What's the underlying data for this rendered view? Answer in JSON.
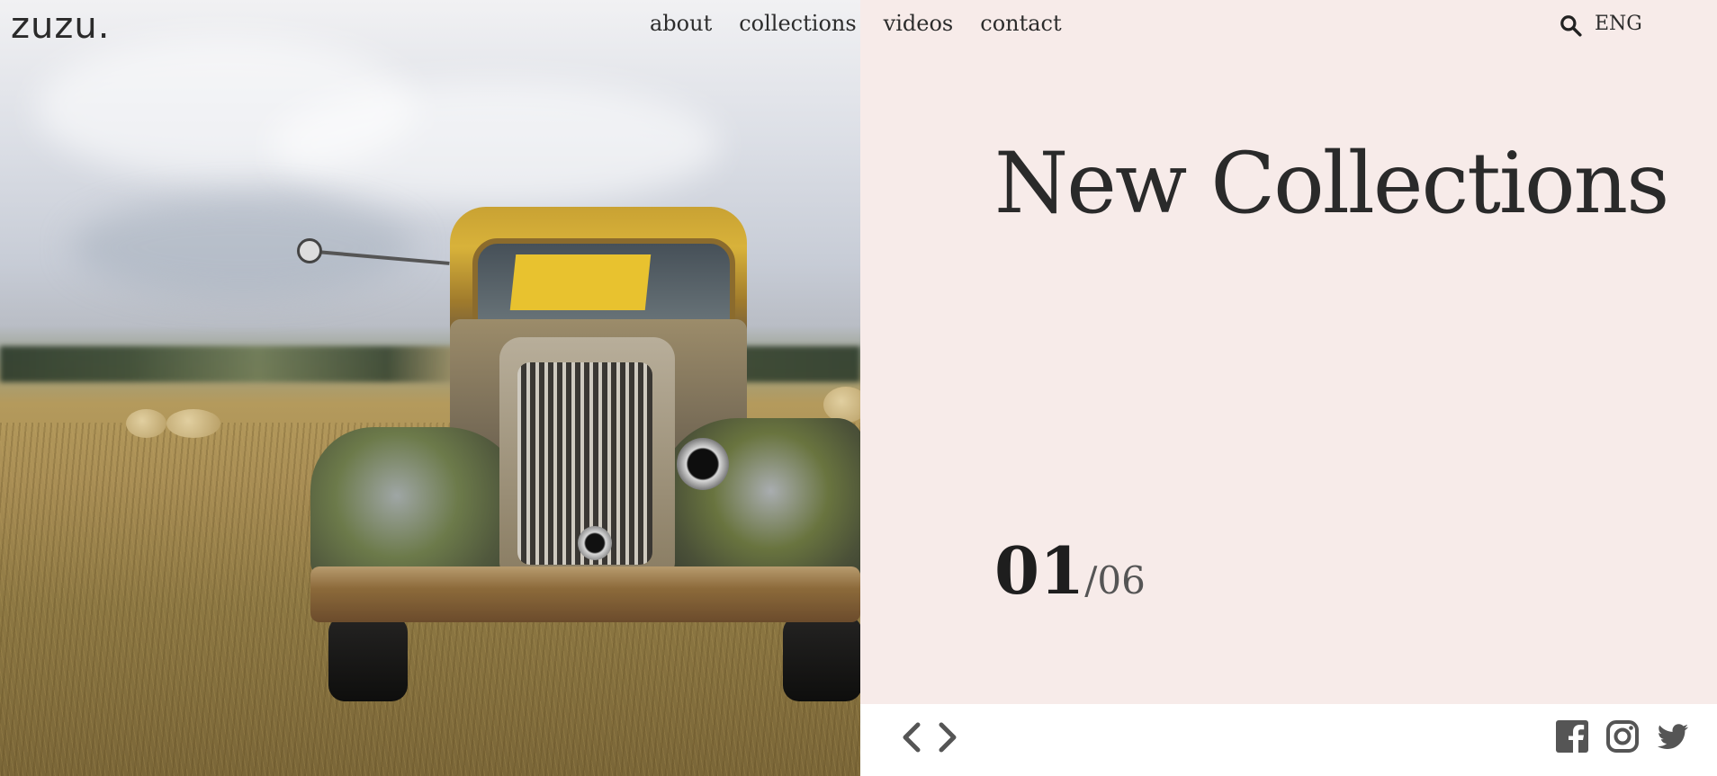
{
  "brand": {
    "logo_text": "zuzu."
  },
  "nav": {
    "items": [
      {
        "label": "about"
      },
      {
        "label": "collections"
      },
      {
        "label": "videos"
      },
      {
        "label": "contact"
      }
    ]
  },
  "header": {
    "search_icon": "search-icon",
    "language": "ENG"
  },
  "slide": {
    "title": "New Collections",
    "current": "01",
    "total": "/06",
    "image": "rusty vintage yellow truck in a grassy field"
  },
  "controls": {
    "prev_icon": "chevron-left-icon",
    "next_icon": "chevron-right-icon"
  },
  "social": [
    {
      "icon": "facebook-icon"
    },
    {
      "icon": "instagram-icon"
    },
    {
      "icon": "twitter-icon"
    }
  ],
  "colors": {
    "panel_bg": "#f7ebe9",
    "text": "#2a2a2a",
    "icon": "#555555"
  }
}
